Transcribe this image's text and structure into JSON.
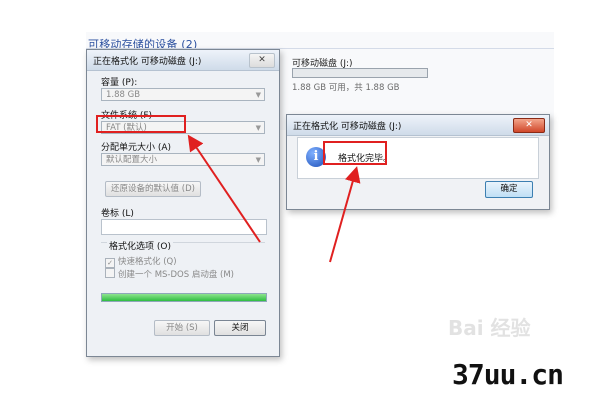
{
  "explorer": {
    "section_title": "可移动存储的设备 (2)",
    "drive_label": "可移动磁盘 (J:)",
    "drive_info": "1.88 GB 可用，共 1.88 GB",
    "drive_usage": 0.0
  },
  "format_dialog": {
    "title": "正在格式化 可移动磁盘 (J:)",
    "close_glyph": "✕",
    "capacity_label": "容量 (P):",
    "capacity_value": "1.88 GB",
    "filesystem_label": "文件系统 (F)",
    "filesystem_value": "FAT (默认)",
    "alloc_label": "分配单元大小 (A)",
    "alloc_value": "默认配置大小",
    "restore_defaults_button": "还原设备的默认值 (D)",
    "volume_label": "卷标 (L)",
    "volume_value": "",
    "options_label": "格式化选项 (O)",
    "quick_format_label": "快速格式化 (Q)",
    "quick_format_checked": true,
    "msdos_boot_label": "创建一个 MS-DOS 启动盘 (M)",
    "msdos_boot_checked": false,
    "progress": 1.0,
    "start_button": "开始 (S)",
    "close_button": "关闭",
    "dropdown_arrow": "▼"
  },
  "message_dialog": {
    "title": "正在格式化 可移动磁盘 (J:)",
    "close_glyph": "✕",
    "info_icon_glyph": "i",
    "message": "格式化完毕。",
    "ok_button": "确定"
  },
  "watermark_text": "Bai 经验",
  "site_logo": "37uu.cn",
  "colors": {
    "highlight": "#e02020",
    "arrow": "#e02020",
    "progress": "#2fbe40",
    "link_blue": "#2a4f9f"
  }
}
